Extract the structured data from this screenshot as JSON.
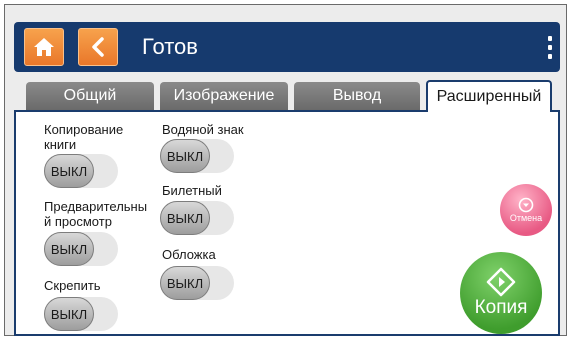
{
  "header": {
    "title": "Готов",
    "home_icon": "home-icon",
    "back_icon": "chevron-left-icon",
    "menu_icon": "more-vertical-icon"
  },
  "tabs": [
    {
      "label": "Общий",
      "active": false
    },
    {
      "label": "Изображение",
      "active": false
    },
    {
      "label": "Вывод",
      "active": false
    },
    {
      "label": "Расширенный",
      "active": true
    }
  ],
  "settings": {
    "book_copy": {
      "label_line1": "Копирование",
      "label_line2": "книги",
      "value": "ВЫКЛ"
    },
    "preview": {
      "label_line1": "Предварительны",
      "label_line2": "й просмотр",
      "value": "ВЫКЛ"
    },
    "staple": {
      "label": "Скрепить",
      "value": "ВЫКЛ"
    },
    "watermark": {
      "label": "Водяной знак",
      "value": "ВЫКЛ"
    },
    "ticket": {
      "label": "Билетный",
      "value": "ВЫКЛ"
    },
    "cover": {
      "label": "Обложка",
      "value": "ВЫКЛ"
    }
  },
  "actions": {
    "cancel_label": "Отмена",
    "copy_label": "Копия"
  },
  "colors": {
    "header_bg": "#163a6e",
    "accent_orange": "#f08a35",
    "copy_green": "#4caf36",
    "cancel_pink": "#ef6a92"
  }
}
